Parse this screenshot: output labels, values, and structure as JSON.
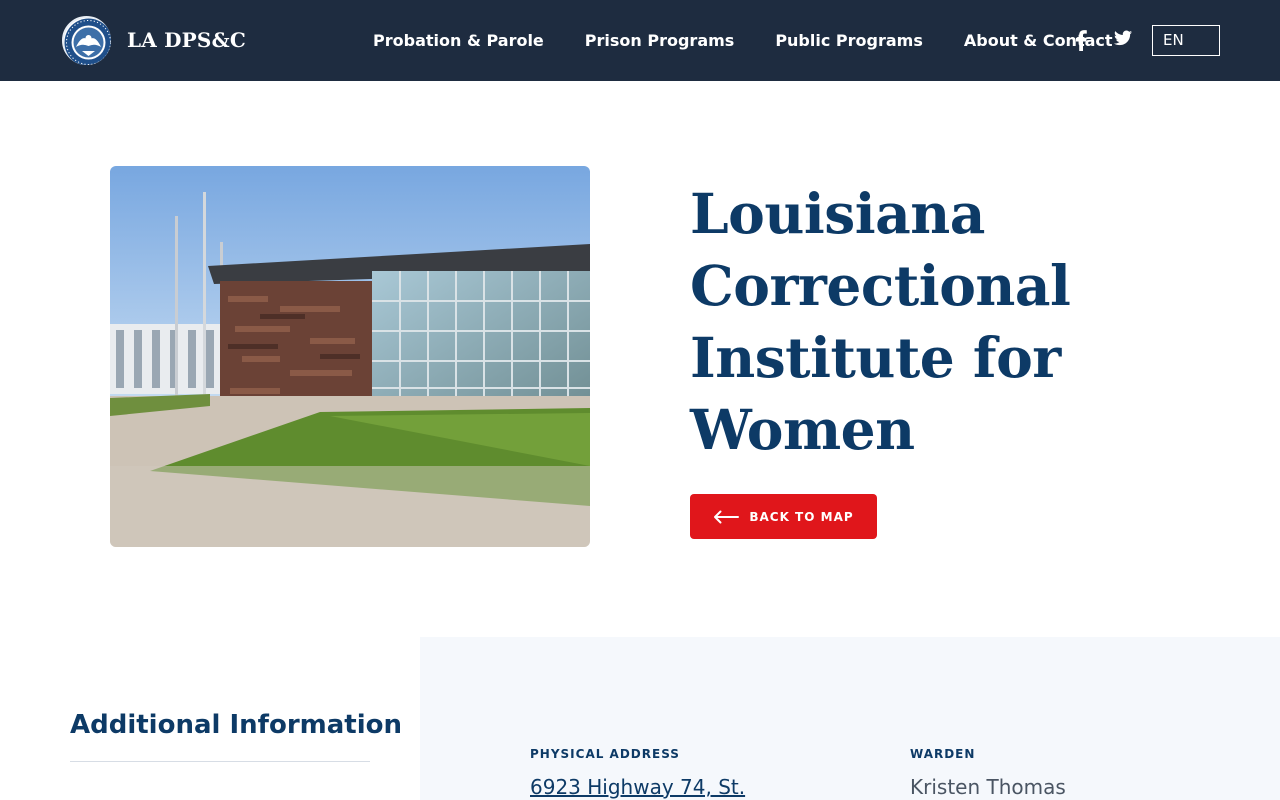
{
  "header": {
    "brand": "LA DPS&C",
    "nav": [
      {
        "label": "Probation & Parole"
      },
      {
        "label": "Prison Programs"
      },
      {
        "label": "Public Programs"
      },
      {
        "label": "About & Contact"
      }
    ],
    "social": [
      {
        "icon": "facebook-icon"
      },
      {
        "icon": "twitter-icon"
      }
    ],
    "language": "EN",
    "colors": {
      "background": "#1e2c40",
      "text": "#ffffff"
    }
  },
  "hero": {
    "title": "Louisiana Correctional Institute for Women",
    "back_button": {
      "label": "BACK TO MAP",
      "icon": "arrow-left-icon",
      "color": "#e0161b"
    }
  },
  "additional_info": {
    "heading": "Additional Information",
    "fields": [
      {
        "label": "PHYSICAL ADDRESS",
        "value": "6923 Highway 74, St."
      },
      {
        "label": "WARDEN",
        "value": "Kristen Thomas"
      }
    ]
  },
  "colors": {
    "accent": "#0d3a66",
    "panel": "#f5f8fc"
  }
}
